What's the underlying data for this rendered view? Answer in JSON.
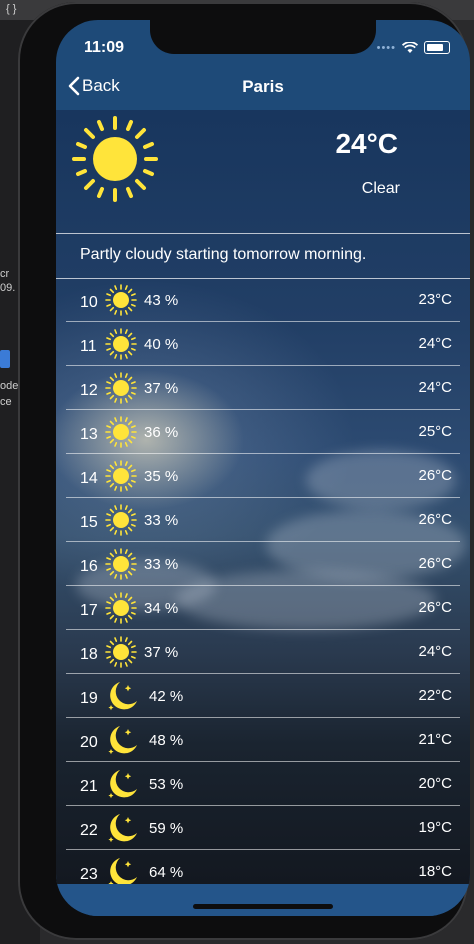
{
  "status_bar": {
    "time": "11:09"
  },
  "nav": {
    "back_label": "Back",
    "title": "Paris"
  },
  "current": {
    "temperature": "24°C",
    "condition": "Clear",
    "icon": "sun-icon"
  },
  "summary": "Partly cloudy starting tomorrow morning.",
  "hourly": [
    {
      "hour": "10",
      "icon": "sun",
      "humidity": "43 %",
      "temp": "23°C"
    },
    {
      "hour": "11",
      "icon": "sun",
      "humidity": "40 %",
      "temp": "24°C"
    },
    {
      "hour": "12",
      "icon": "sun",
      "humidity": "37 %",
      "temp": "24°C"
    },
    {
      "hour": "13",
      "icon": "sun",
      "humidity": "36 %",
      "temp": "25°C"
    },
    {
      "hour": "14",
      "icon": "sun",
      "humidity": "35 %",
      "temp": "26°C"
    },
    {
      "hour": "15",
      "icon": "sun",
      "humidity": "33 %",
      "temp": "26°C"
    },
    {
      "hour": "16",
      "icon": "sun",
      "humidity": "33 %",
      "temp": "26°C"
    },
    {
      "hour": "17",
      "icon": "sun",
      "humidity": "34 %",
      "temp": "26°C"
    },
    {
      "hour": "18",
      "icon": "sun",
      "humidity": "37 %",
      "temp": "24°C"
    },
    {
      "hour": "19",
      "icon": "moon",
      "humidity": "42 %",
      "temp": "22°C"
    },
    {
      "hour": "20",
      "icon": "moon",
      "humidity": "48 %",
      "temp": "21°C"
    },
    {
      "hour": "21",
      "icon": "moon",
      "humidity": "53 %",
      "temp": "20°C"
    },
    {
      "hour": "22",
      "icon": "moon",
      "humidity": "59 %",
      "temp": "19°C"
    },
    {
      "hour": "23",
      "icon": "moon",
      "humidity": "64 %",
      "temp": "18°C"
    }
  ],
  "colors": {
    "nav_blue": "#24558a",
    "sun_yellow": "#ffe43a"
  },
  "desktop_fragments": [
    "{ }",
    "cr",
    "09.",
    "ode",
    "ce"
  ]
}
